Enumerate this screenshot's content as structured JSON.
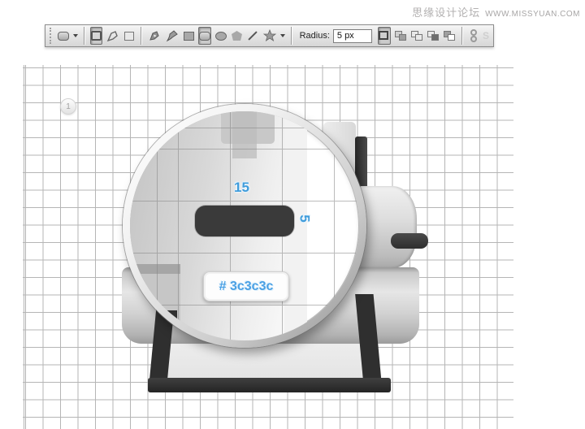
{
  "watermark": {
    "site_name": "思缘设计论坛",
    "site_url": "WWW.MISSYUAN.COM"
  },
  "toolbar": {
    "radius_label": "Radius:",
    "radius_value": "5 px",
    "style_hint": "S"
  },
  "canvas": {
    "step_badge": "1",
    "loupe": {
      "width_label": "15",
      "height_label": "5",
      "color_tooltip": "# 3c3c3c"
    },
    "colors": {
      "shape_dark": "#3c3c3c",
      "dimension_blue": "#3f9cdb",
      "grid_line": "#b5b5b5"
    }
  }
}
